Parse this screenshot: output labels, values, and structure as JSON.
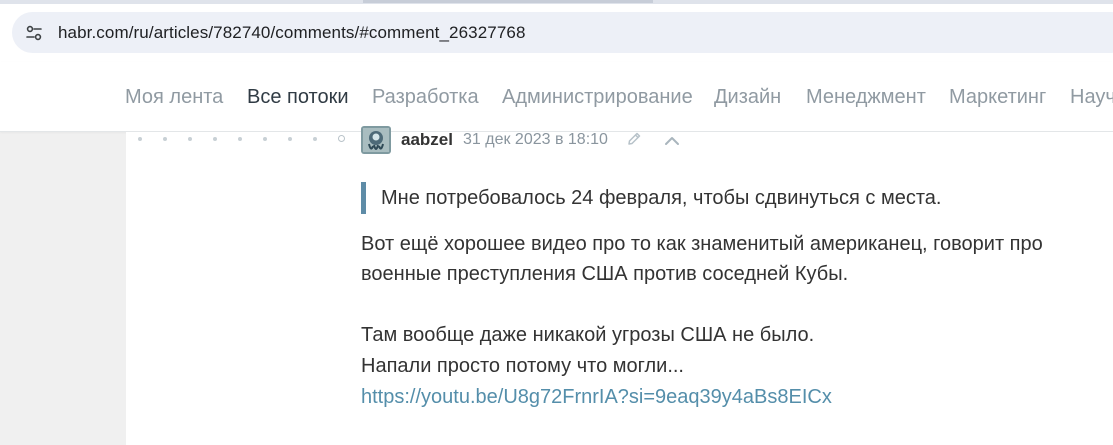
{
  "browser": {
    "url": "habr.com/ru/articles/782740/comments/#comment_26327768",
    "site_info_icon": "tune-icon"
  },
  "nav": {
    "items": [
      {
        "label": "Моя лента",
        "active": false
      },
      {
        "label": "Все потоки",
        "active": true
      },
      {
        "label": "Разработка",
        "active": false
      },
      {
        "label": "Администрирование",
        "active": false
      },
      {
        "label": "Дизайн",
        "active": false
      },
      {
        "label": "Менеджмент",
        "active": false
      },
      {
        "label": "Маркетинг",
        "active": false
      },
      {
        "label": "Науч",
        "active": false
      }
    ]
  },
  "comment": {
    "author": "aabzel",
    "timestamp": "31 дек 2023 в 18:10",
    "quote": "Мне потребовалось 24 февраля, чтобы сдвинуться с места.",
    "paragraphs": [
      "Вот ещё хорошее видео про то как знаменитый американец, говорит про",
      "военные преступления США против соседней Кубы.",
      "Там вообще даже никакой угрозы США не было.",
      "Напали просто потому что могли..."
    ],
    "link": "https://youtu.be/U8g72FrnrIA?si=9eaq39y4aBs8EICx"
  },
  "colors": {
    "nav_text": "#909aa2",
    "nav_active": "#303b44",
    "link": "#548eaa",
    "quote_bar": "#5e8ca7"
  }
}
